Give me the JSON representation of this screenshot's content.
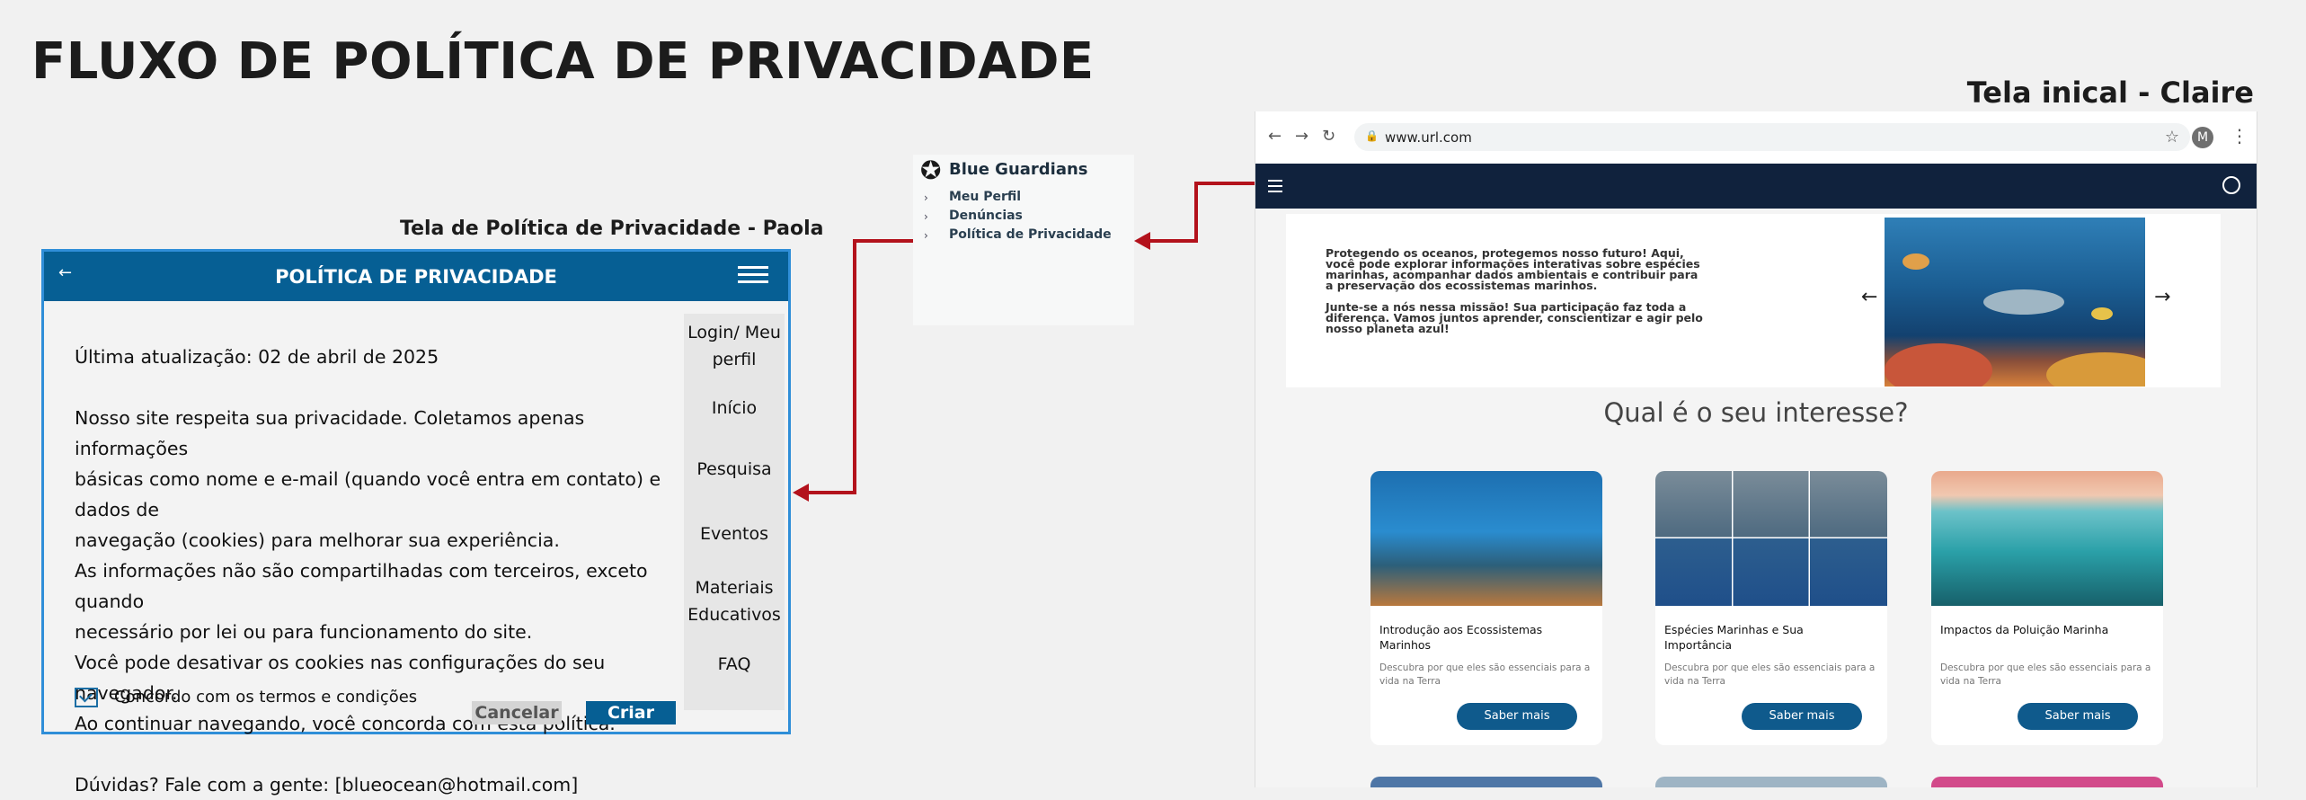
{
  "page": {
    "title": "FLUXO DE POLÍTICA DE PRIVACIDADE",
    "claire_label": "Tela inical - Claire",
    "paola_label": "Tela de Política de Privacidade - Paola"
  },
  "privacy": {
    "back_icon": "←",
    "title": "POLÍTICA DE PRIVACIDADE",
    "updated": "Última atualização: 02 de abril de 2025",
    "lines": [
      "Nosso site respeita sua privacidade. Coletamos apenas informações",
      "básicas como nome e e-mail (quando você entra em contato) e dados de",
      "navegação (cookies) para melhorar sua experiência.",
      "As informações não são compartilhadas com terceiros, exceto quando",
      "necessário por lei ou para funcionamento do site.",
      "Você pode desativar os cookies nas configurações do seu navegador.",
      "Ao continuar navegando, você concorda com esta política."
    ],
    "contact": "Dúvidas? Fale com a gente: [blueocean@hotmail.com]",
    "consent": "Concordo com  os termos e condições",
    "cancel": "Cancelar",
    "create": "Criar",
    "side_menu": [
      "Login/ Meu perfil",
      "Início",
      "Pesquisa",
      "Eventos",
      "Materiais Educativos",
      "FAQ"
    ]
  },
  "nav_panel": {
    "brand": "Blue Guardians",
    "items": [
      "Meu Perfil",
      "Denúncias",
      "Política de Privacidade"
    ]
  },
  "browser": {
    "url": "www.url.com",
    "avatar": "M",
    "hero_p1": "Protegendo os oceanos, protegemos nosso futuro! Aqui, você pode explorar informações interativas sobre espécies marinhas, acompanhar dados ambientais e contribuir para a preservação dos ecossistemas marinhos.",
    "hero_p2": "Junte-se a nós nessa missão! Sua participação faz toda a diferença. Vamos juntos aprender, conscientizar e agir pelo nosso planeta azul!",
    "interest_title": "Qual é o seu interesse?",
    "cards": [
      {
        "title": "Introdução aos Ecossistemas Marinhos",
        "desc": "Descubra por que eles são essenciais para a vida na Terra",
        "button": "Saber mais"
      },
      {
        "title": "Espécies Marinhas e Sua Importância",
        "desc": "Descubra por que eles são essenciais para a vida na Terra",
        "button": "Saber mais"
      },
      {
        "title": "Impactos da Poluição Marinha",
        "desc": "Descubra por que eles são essenciais para a vida na Terra",
        "button": "Saber mais"
      }
    ]
  },
  "colors": {
    "accent": "#065f94",
    "arrow": "#b3121c",
    "site_nav": "#10223d"
  }
}
